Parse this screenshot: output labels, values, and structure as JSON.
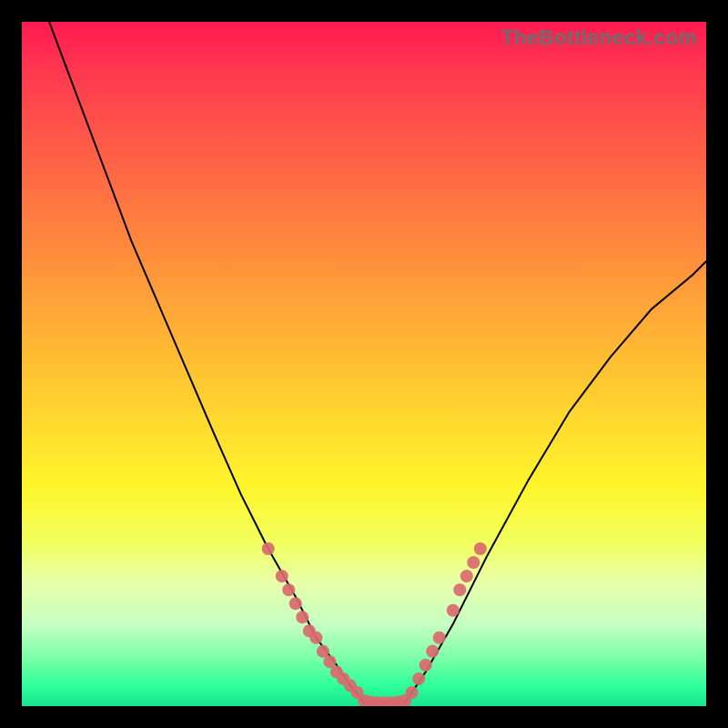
{
  "watermark": {
    "text": "TheBottleneck.com"
  },
  "chart_data": {
    "type": "line",
    "title": "",
    "xlabel": "",
    "ylabel": "",
    "xlim": [
      0,
      100
    ],
    "ylim": [
      0,
      100
    ],
    "grid": false,
    "legend": false,
    "series": [
      {
        "name": "left-curve",
        "x": [
          4,
          10,
          16,
          22,
          28,
          32,
          36,
          40,
          43,
          46,
          48,
          50
        ],
        "y": [
          100,
          84,
          68,
          54,
          40,
          31,
          23,
          16,
          10,
          6,
          3,
          0.5
        ],
        "stroke": "#000000",
        "stroke_width": 2
      },
      {
        "name": "valley-floor",
        "x": [
          50,
          56
        ],
        "y": [
          0.5,
          0.5
        ],
        "stroke": "#000000",
        "stroke_width": 2
      },
      {
        "name": "right-curve",
        "x": [
          56,
          59,
          63,
          68,
          74,
          80,
          86,
          92,
          98,
          100
        ],
        "y": [
          0.5,
          5,
          12,
          22,
          33,
          43,
          51,
          58,
          63,
          65
        ],
        "stroke": "#000000",
        "stroke_width": 2
      }
    ],
    "scatter": [
      {
        "name": "left-cluster",
        "color": "#d96a6f",
        "radius": 7,
        "points": [
          [
            36,
            23
          ],
          [
            38,
            19
          ],
          [
            39,
            17
          ],
          [
            40,
            15
          ],
          [
            41,
            13
          ],
          [
            42,
            11
          ],
          [
            43,
            10
          ],
          [
            44,
            8
          ],
          [
            45,
            6.5
          ],
          [
            46,
            5
          ],
          [
            47,
            4
          ],
          [
            48,
            3
          ],
          [
            49,
            2
          ]
        ]
      },
      {
        "name": "valley-cluster",
        "color": "#d96a6f",
        "radius": 7,
        "points": [
          [
            50,
            0.8
          ],
          [
            51,
            0.6
          ],
          [
            52,
            0.5
          ],
          [
            53,
            0.5
          ],
          [
            54,
            0.5
          ],
          [
            55,
            0.6
          ],
          [
            56,
            0.8
          ]
        ]
      },
      {
        "name": "right-cluster",
        "color": "#d96a6f",
        "radius": 7,
        "points": [
          [
            57,
            2
          ],
          [
            58,
            4
          ],
          [
            59,
            6
          ],
          [
            60,
            8
          ],
          [
            61,
            10
          ],
          [
            63,
            14
          ],
          [
            64,
            17
          ],
          [
            65,
            19
          ],
          [
            66,
            21
          ],
          [
            67,
            23
          ]
        ]
      }
    ],
    "background_gradient": {
      "top": "#ff1a52",
      "bottom": "#19e48f"
    }
  }
}
